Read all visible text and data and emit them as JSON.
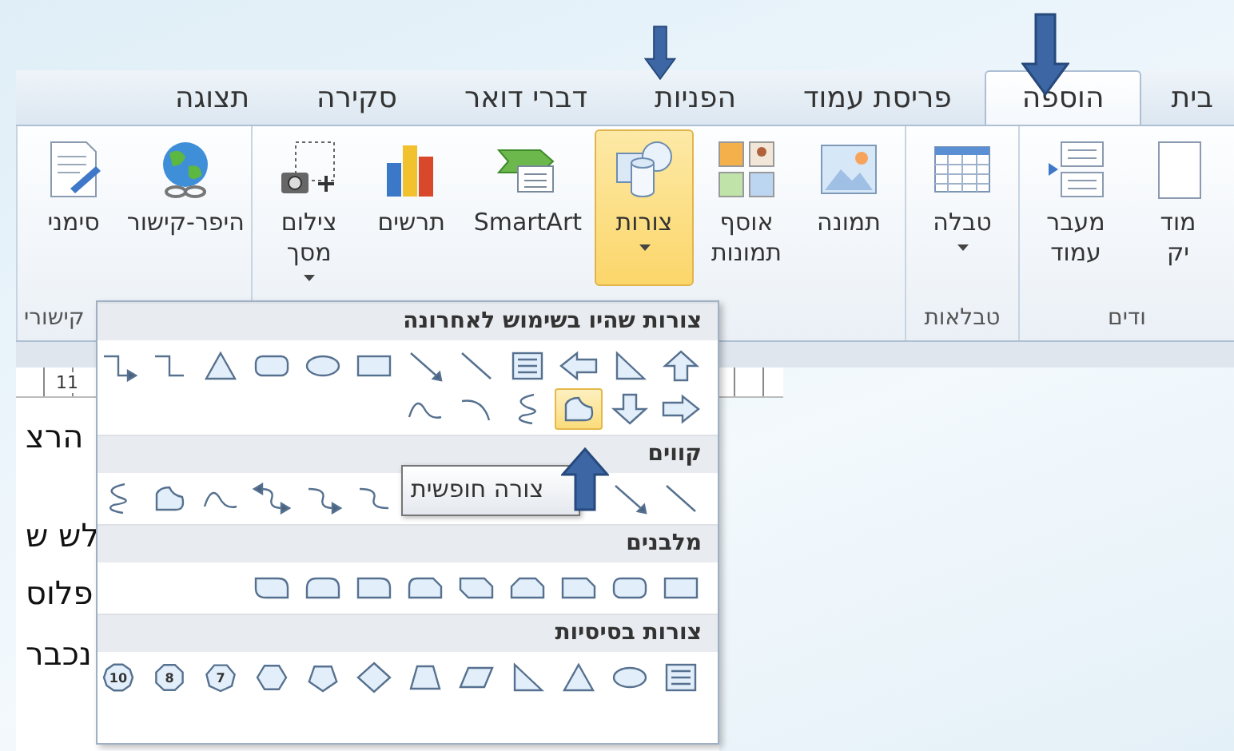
{
  "tabs": [
    {
      "label": "בית",
      "selected": false
    },
    {
      "label": "הוספה",
      "selected": true
    },
    {
      "label": "פריסת עמוד",
      "selected": false
    },
    {
      "label": "הפניות",
      "selected": false
    },
    {
      "label": "דברי דואר",
      "selected": false
    },
    {
      "label": "סקירה",
      "selected": false
    },
    {
      "label": "תצוגה",
      "selected": false
    }
  ],
  "ribbon_groups": [
    {
      "label": "ודים",
      "buttons": [
        {
          "kind": "page",
          "lines": [
            "מוד",
            "יק"
          ],
          "dropdown": false,
          "pressed": false
        },
        {
          "kind": "page-break",
          "lines": [
            "מעבר",
            "עמוד"
          ],
          "dropdown": false,
          "pressed": false
        }
      ]
    },
    {
      "label": "טבלאות",
      "buttons": [
        {
          "kind": "table",
          "lines": [
            "טבלה"
          ],
          "dropdown": true,
          "pressed": false
        }
      ]
    },
    {
      "buttons": [
        {
          "kind": "picture",
          "lines": [
            "תמונה"
          ],
          "dropdown": false,
          "pressed": false
        },
        {
          "kind": "clip-art",
          "lines": [
            "אוסף",
            "תמונות"
          ],
          "dropdown": false,
          "pressed": false
        },
        {
          "kind": "shapes",
          "lines": [
            "צורות"
          ],
          "dropdown": true,
          "pressed": true
        },
        {
          "kind": "smartart",
          "lines": [
            "SmartArt"
          ],
          "dropdown": false,
          "pressed": false
        },
        {
          "kind": "chart",
          "lines": [
            "תרשים"
          ],
          "dropdown": false,
          "pressed": false
        },
        {
          "kind": "screenshot",
          "lines": [
            "צילום",
            "מסך"
          ],
          "dropdown": true,
          "pressed": false
        }
      ]
    },
    {
      "label": "קישורי",
      "buttons": [
        {
          "kind": "hyperlink",
          "lines": [
            "היפר-קישור"
          ],
          "dropdown": false,
          "pressed": false
        },
        {
          "kind": "bookmark",
          "lines": [
            "סימני"
          ],
          "dropdown": false,
          "pressed": false
        }
      ]
    }
  ],
  "ruler": {
    "label": "11"
  },
  "document": {
    "lines": [
      "הרצ",
      "לש ש",
      "פלוס",
      "נכבר"
    ]
  },
  "shapes_menu": {
    "sections": [
      {
        "title": "צורות שהיו בשימוש לאחרונה",
        "items": [
          {
            "kind": "up-arrow",
            "selected": false
          },
          {
            "kind": "right-triangle",
            "selected": false
          },
          {
            "kind": "left-arrow",
            "selected": false
          },
          {
            "kind": "text-box",
            "selected": false
          },
          {
            "kind": "line",
            "selected": false
          },
          {
            "kind": "arrow-line",
            "selected": false
          },
          {
            "kind": "rect",
            "selected": false
          },
          {
            "kind": "oval",
            "selected": false
          },
          {
            "kind": "rounded-rect",
            "selected": false
          },
          {
            "kind": "triangle",
            "selected": false
          },
          {
            "kind": "elbow",
            "selected": false
          },
          {
            "kind": "elbow-arrow",
            "selected": false
          },
          {
            "kind": "right-arrow",
            "selected": false
          },
          {
            "kind": "down-arrow",
            "selected": false
          },
          {
            "kind": "freeform",
            "selected": true
          },
          {
            "kind": "scribble",
            "selected": false
          },
          {
            "kind": "arc",
            "selected": false
          },
          {
            "kind": "curve",
            "selected": false
          }
        ]
      },
      {
        "title": "קווים",
        "items": [
          {
            "kind": "line",
            "selected": false
          },
          {
            "kind": "arrow-line",
            "selected": false
          },
          {
            "kind": "tooltip",
            "text": "צורה חופשית"
          },
          {
            "kind": "curved-connector",
            "selected": false
          },
          {
            "kind": "curved-arrow",
            "selected": false
          },
          {
            "kind": "curved-double-arrow",
            "selected": false
          },
          {
            "kind": "curve",
            "selected": false
          },
          {
            "kind": "freeform",
            "selected": false
          },
          {
            "kind": "scribble",
            "selected": false
          }
        ]
      },
      {
        "title": "מלבנים",
        "items": [
          {
            "kind": "rect",
            "selected": false
          },
          {
            "kind": "rounded-rect",
            "selected": false
          },
          {
            "kind": "snip-corner",
            "selected": false
          },
          {
            "kind": "snip-two",
            "selected": false
          },
          {
            "kind": "snip-diagonal",
            "selected": false
          },
          {
            "kind": "snip-round",
            "selected": false
          },
          {
            "kind": "round-corner",
            "selected": false
          },
          {
            "kind": "round-two",
            "selected": false
          },
          {
            "kind": "round-diagonal",
            "selected": false
          }
        ]
      },
      {
        "title": "צורות בסיסיות",
        "items": [
          {
            "kind": "text-box",
            "selected": false
          },
          {
            "kind": "oval",
            "selected": false
          },
          {
            "kind": "triangle",
            "selected": false
          },
          {
            "kind": "right-triangle",
            "selected": false
          },
          {
            "kind": "parallelogram",
            "selected": false
          },
          {
            "kind": "trapezoid",
            "selected": false
          },
          {
            "kind": "diamond",
            "selected": false
          },
          {
            "kind": "pentagon",
            "selected": false
          },
          {
            "kind": "hexagon",
            "selected": false
          },
          {
            "kind": "heptagon",
            "label": "7",
            "selected": false
          },
          {
            "kind": "octagon",
            "label": "8",
            "selected": false
          },
          {
            "kind": "decagon",
            "label": "10",
            "selected": false
          }
        ]
      }
    ]
  }
}
